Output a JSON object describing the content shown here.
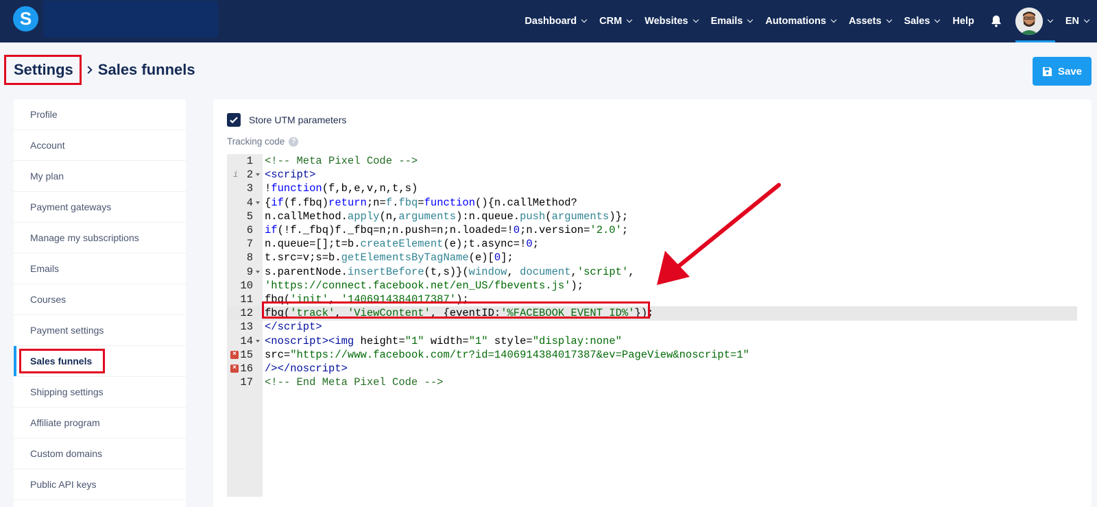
{
  "topbar": {
    "logo_letter": "S",
    "nav": [
      {
        "label": "Dashboard",
        "has_dropdown": true
      },
      {
        "label": "CRM",
        "has_dropdown": true
      },
      {
        "label": "Websites",
        "has_dropdown": true
      },
      {
        "label": "Emails",
        "has_dropdown": true
      },
      {
        "label": "Automations",
        "has_dropdown": true
      },
      {
        "label": "Assets",
        "has_dropdown": true
      },
      {
        "label": "Sales",
        "has_dropdown": true
      },
      {
        "label": "Help",
        "has_dropdown": false
      }
    ],
    "language": "EN",
    "bell_icon": "bell-icon"
  },
  "breadcrumb": {
    "root": "Settings",
    "current": "Sales funnels"
  },
  "toolbar": {
    "save_label": "Save",
    "accent_color": "#1b9bf0"
  },
  "sidebar": {
    "items": [
      {
        "label": "Profile"
      },
      {
        "label": "Account"
      },
      {
        "label": "My plan"
      },
      {
        "label": "Payment gateways"
      },
      {
        "label": "Manage my subscriptions"
      },
      {
        "label": "Emails"
      },
      {
        "label": "Courses"
      },
      {
        "label": "Payment settings"
      },
      {
        "label": "Sales funnels",
        "active": true
      },
      {
        "label": "Shipping settings"
      },
      {
        "label": "Affiliate program"
      },
      {
        "label": "Custom domains"
      },
      {
        "label": "Public API keys"
      }
    ]
  },
  "main": {
    "utm_label": "Store UTM parameters",
    "utm_checked": true,
    "tracking_label": "Tracking code",
    "help_glyph": "?",
    "editor": {
      "line_numbers": [
        "1",
        "2",
        "3",
        "4",
        "5",
        "6",
        "7",
        "8",
        "9",
        "10",
        "11",
        "12",
        "13",
        "14",
        "15",
        "16",
        "17"
      ],
      "info_marker": "i",
      "error_glyph": "×",
      "highlighted_line": 12
    }
  }
}
